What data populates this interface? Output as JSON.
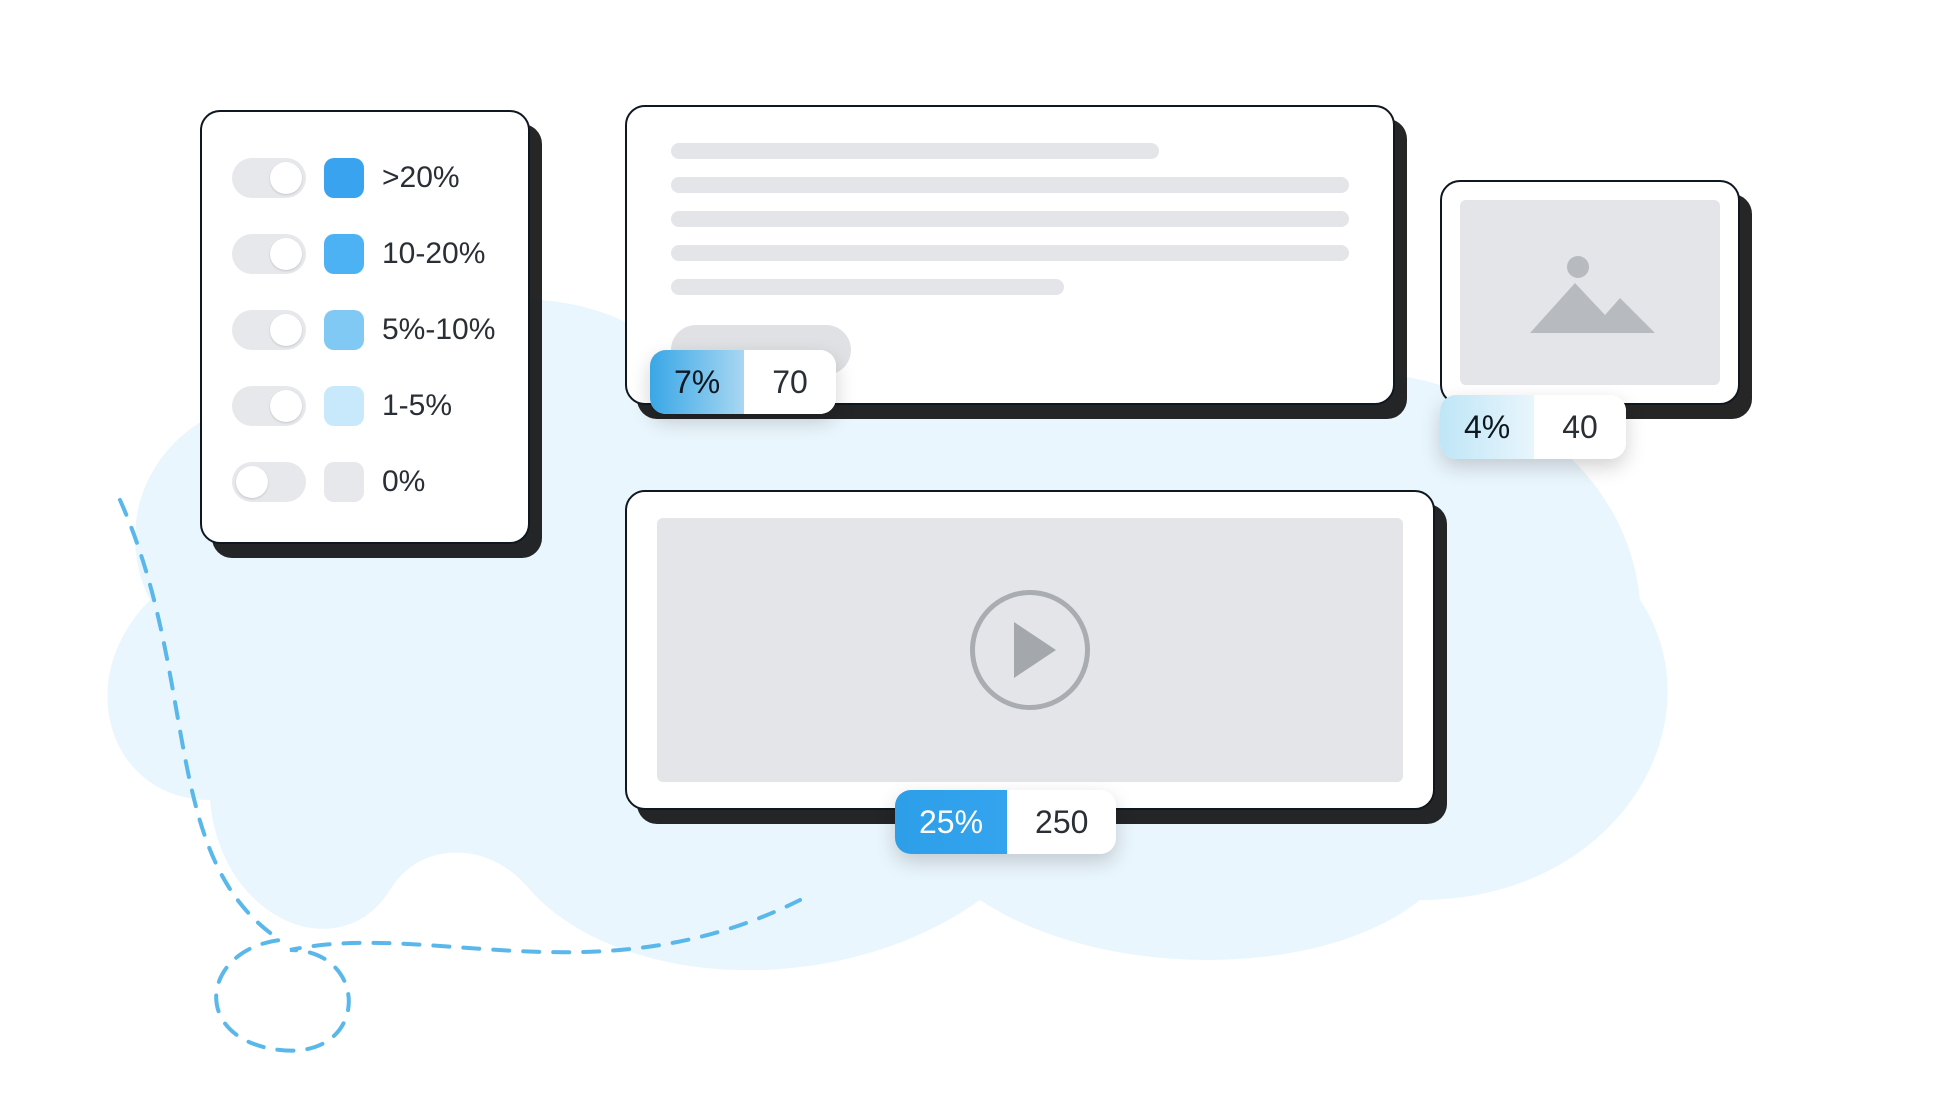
{
  "legend": {
    "items": [
      {
        "label": ">20%",
        "color": "#3aa3ef",
        "enabled": true
      },
      {
        "label": "10-20%",
        "color": "#4db2f4",
        "enabled": true
      },
      {
        "label": "5%-10%",
        "color": "#7fc9f4",
        "enabled": true
      },
      {
        "label": "1-5%",
        "color": "#c7e9fb",
        "enabled": true
      },
      {
        "label": "0%",
        "color": "#e6e8eb",
        "enabled": false
      }
    ]
  },
  "stats": {
    "text": {
      "percent": "7%",
      "count": "70"
    },
    "video": {
      "percent": "25%",
      "count": "250"
    },
    "image": {
      "percent": "4%",
      "count": "40"
    }
  }
}
